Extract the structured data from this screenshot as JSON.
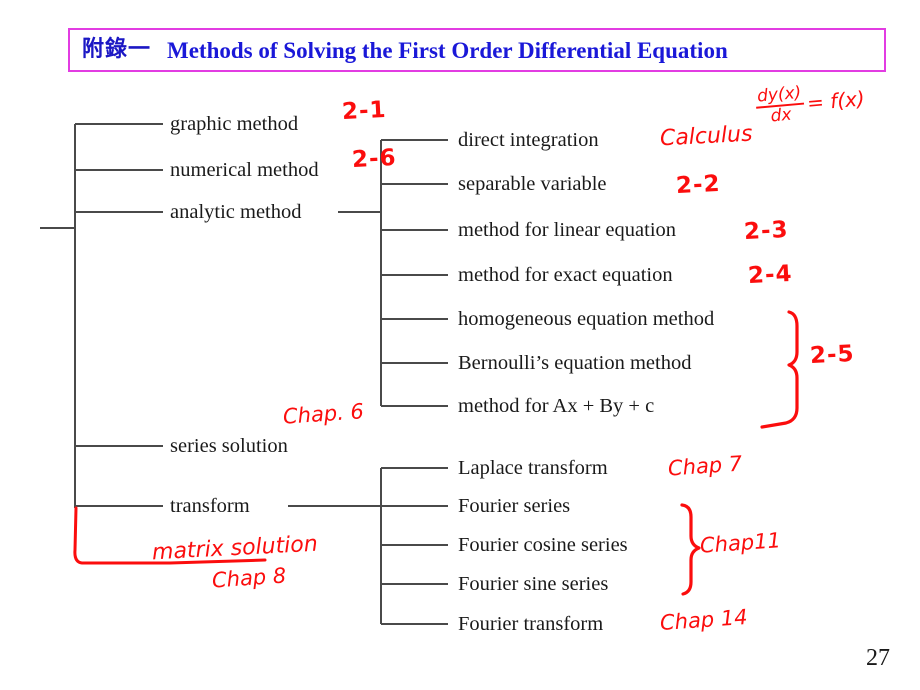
{
  "title": {
    "chinese": "附錄一",
    "english": "Methods of Solving the First Order Differential Equation",
    "border_color": "#e23ce2",
    "text_color": "#1a18d8"
  },
  "page": {
    "number": "27"
  },
  "colors": {
    "annotation_red": "#fb0d0d",
    "tree_line": "#4a4a4a",
    "node_text": "#1a1a1a"
  },
  "tree": {
    "level1": [
      {
        "label": "graphic method"
      },
      {
        "label": "numerical method"
      },
      {
        "label": "analytic method"
      },
      {
        "label": "series solution"
      },
      {
        "label": "transform"
      }
    ],
    "analytic_children": [
      {
        "label": "direct integration"
      },
      {
        "label": "separable variable"
      },
      {
        "label": "method for linear equation"
      },
      {
        "label": "method for exact equation"
      },
      {
        "label": "homogeneous equation method"
      },
      {
        "label": "Bernoulli’s equation method"
      },
      {
        "label": "method for Ax + By + c"
      }
    ],
    "transform_children": [
      {
        "label": "Laplace transform"
      },
      {
        "label": "Fourier series"
      },
      {
        "label": "Fourier cosine series"
      },
      {
        "label": "Fourier sine series"
      },
      {
        "label": "Fourier transform"
      }
    ]
  },
  "annotations": {
    "graphic_method": "2-1",
    "numerical_method": "2-6",
    "direct_integration": "Calculus",
    "derivative_num": "dy(x)",
    "derivative_den": "dx",
    "derivative_rhs": "= f(x)",
    "separable_variable": "2-2",
    "linear_equation": "2-3",
    "exact_equation": "2-4",
    "brace_group_2_5": "2-5",
    "series_solution": "Chap. 6",
    "matrix_solution": "matrix solution",
    "matrix_solution_chapter": "Chap 8",
    "laplace_transform": "Chap 7",
    "fourier_brace": "Chap11",
    "fourier_transform": "Chap 14"
  }
}
